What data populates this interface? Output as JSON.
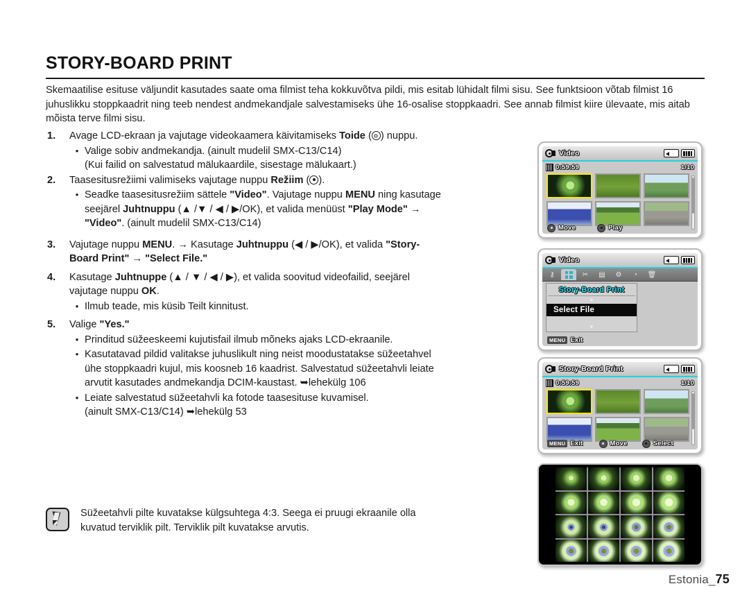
{
  "page": {
    "heading": "STORY-BOARD PRINT",
    "footer_label": "Estonia_",
    "footer_page": "75"
  },
  "intro": "Skemaatilise esituse väljundit kasutades saate oma filmist teha kokkuvõtva pildi, mis esitab lühidalt filmi sisu. See funktsioon võtab filmist 16 juhuslikku stoppkaadrit ning teeb nendest andmekandjale salvestamiseks ühe 16-osalise stoppkaadri. See annab filmist kiire ülevaate, mis aitab mõista terve filmi sisu.",
  "steps": {
    "s1": {
      "num": "1.",
      "t1": "Avage LCD-ekraan ja vajutage videokaamera käivitamiseks ",
      "b1": "Toide",
      "t2": " (",
      "t3": ") nuppu.",
      "bullets": [
        "Valige sobiv andmekandja. (ainult mudelil SMX-C13/C14)",
        "(Kui failid on salvestatud mälukaardile, sisestage mälukaart.)"
      ]
    },
    "s2": {
      "num": "2.",
      "t1": "Taasesitusrežiimi valimiseks vajutage nuppu ",
      "b1": "Režiim",
      "t2": " (",
      "t3": ").",
      "bullet_l1a": "Seadke taasesitusrežiim sättele ",
      "bullet_l1b": "\"Video\"",
      "bullet_l1c": ". Vajutage nuppu ",
      "bullet_l1d": "MENU",
      "bullet_l1e": " ning kasutage",
      "bullet_l2a": "seejärel ",
      "bullet_l2b": "Juhtnuppu",
      "bullet_l2c": " (▲ /▼ / ◀ / ▶/OK), et valida menüüst ",
      "bullet_l2d": "\"Play Mode\"",
      "bullet_l2e": " →",
      "bullet_l3a": "\"Video\"",
      "bullet_l3b": ". (ainult mudelil SMX-C13/C14)"
    },
    "s3": {
      "num": "3.",
      "t1": "Vajutage nuppu ",
      "b1": "MENU",
      "t2": ". → Kasutage ",
      "b2": "Juhtnuppu",
      "t3": " (◀ / ▶/OK), et valida ",
      "b3": "\"Story-",
      "l2a": "Board Print\"",
      "l2b": " → ",
      "l2c": "\"Select File.\""
    },
    "s4": {
      "num": "4.",
      "t1": "Kasutage ",
      "b1": "Juhtnuppe",
      "t2": " (▲ / ▼ / ◀ / ▶), et valida soovitud videofailid, seejärel",
      "l2a": "vajutage nuppu ",
      "l2b": "OK",
      "l2c": ".",
      "bullet": "Ilmub teade, mis küsib Teilt kinnitust."
    },
    "s5": {
      "num": "5.",
      "t1": "Valige ",
      "b1": "\"Yes.\"",
      "bullets": [
        "Prinditud süžeeskeemi kujutisfail ilmub mõneks ajaks LCD-ekraanile."
      ],
      "bullet2_l1": "Kasutatavad pildid valitakse juhuslikult ning neist moodustatakse süžeetahvel",
      "bullet2_l2": "ühe stoppkaadri kujul, mis koosneb 16 kaadrist.  Salvestatud süžeetahvli leiate",
      "bullet2_l3a": "arvutit kasutades andmekandja DCIM-kaustast. ",
      "bullet2_l3b": "➥lehekülg 106",
      "bullet3_l1": "Leiate salvestatud süžeetahvli ka fotode taasesituse kuvamisel.",
      "bullet3_l2a": "(ainult SMX-C13/C14) ",
      "bullet3_l2b": "➥lehekülg 53"
    }
  },
  "note": {
    "line1": "Süžeetahvli pilte kuvatakse külgsuhtega 4:3. Seega ei pruugi ekraanile olla",
    "line2": "kuvatud terviklik pilt. Terviklik pilt kuvatakse arvutis."
  },
  "lcd1": {
    "title": "Video",
    "time": "0:59:59",
    "counter": "1/10",
    "btn_move": "Move",
    "btn_play": "Play"
  },
  "lcd2": {
    "title": "Video",
    "menu_heading": "Story-Board Print",
    "menu_item": "Select File",
    "menu_key": "MENU",
    "exit": "Exit",
    "tabs": [
      "key-icon",
      "grid-icon",
      "scissors-icon",
      "book-icon",
      "gear-icon",
      "share-icon",
      "trash-icon"
    ]
  },
  "lcd3": {
    "title": "Story-Board Print",
    "time": "0:59:59",
    "counter": "1/10",
    "menu_key": "MENU",
    "exit": "Exit",
    "btn_move": "Move",
    "btn_select": "Select"
  },
  "colors": {
    "accent_cyan": "#22d2e0",
    "selection_yellow": "#ffe600",
    "menu_heading": "#2fe3f5"
  }
}
